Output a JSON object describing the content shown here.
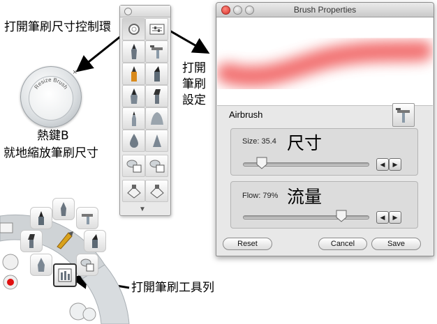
{
  "annotations": {
    "open_resize_control": "打開筆刷尺寸控制環",
    "open_brush_settings_lines": [
      "打開",
      "筆刷",
      "設定"
    ],
    "hotkey_title": "熱鍵B",
    "hotkey_desc": "就地縮放筆刷尺寸",
    "open_toolbar": "打開筆刷工具列",
    "size_cn": "尺寸",
    "flow_cn": "流量"
  },
  "resize_control": {
    "label": "Resize Brush",
    "close_glyph": "×"
  },
  "brush_window": {
    "title": "Brush Properties",
    "brush_name": "Airbrush",
    "size_label": "Size: 35.4",
    "size_value_fraction": 0.15,
    "flow_label": "Flow: 79%",
    "flow_value_fraction": 0.79,
    "reset_label": "Reset",
    "cancel_label": "Cancel",
    "save_label": "Save",
    "stroke_color": "#f05a5a"
  },
  "toolbar": {
    "footer_glyph": "▼"
  },
  "icons": [
    "circle-brush-icon",
    "brush-settings-icon",
    "pen-icon",
    "airbrush-icon",
    "marker-icon",
    "chisel-icon",
    "nib-icon",
    "flat-brush-icon",
    "pencil-icon",
    "smudge-icon",
    "drop-icon",
    "triangle-icon",
    "stamp-icon",
    "eraser-icon"
  ]
}
